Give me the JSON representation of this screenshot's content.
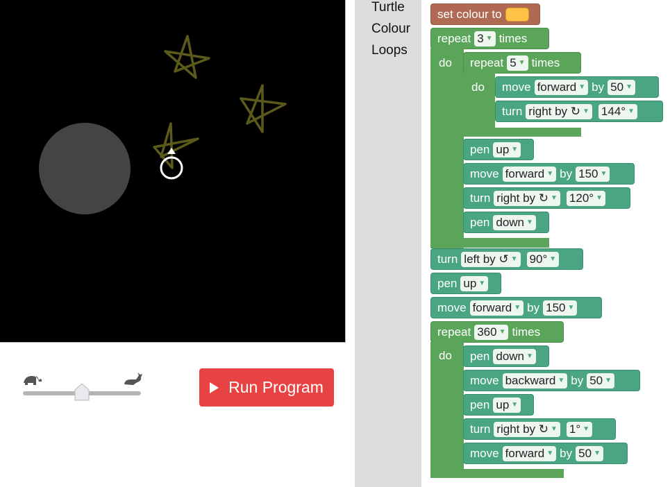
{
  "run_button": {
    "label": "Run Program"
  },
  "toolbox": {
    "items": [
      "Turtle",
      "Colour",
      "Loops"
    ]
  },
  "blocks": {
    "set_colour": {
      "label": "set colour to",
      "colour": "#ffc247"
    },
    "repeat_outer": {
      "label": "repeat",
      "count": "3",
      "times": "times",
      "do": "do"
    },
    "repeat_inner": {
      "label": "repeat",
      "count": "5",
      "times": "times",
      "do": "do"
    },
    "move1": {
      "label": "move",
      "dir": "forward",
      "by": "by",
      "amount": "50"
    },
    "turn1": {
      "label": "turn",
      "dir": "right by ↻",
      "angle": "144°"
    },
    "pen1": {
      "label": "pen",
      "state": "up"
    },
    "move2": {
      "label": "move",
      "dir": "forward",
      "by": "by",
      "amount": "150"
    },
    "turn2": {
      "label": "turn",
      "dir": "right by ↻",
      "angle": "120°"
    },
    "pen2": {
      "label": "pen",
      "state": "down"
    },
    "turn3": {
      "label": "turn",
      "dir": "left by ↺",
      "angle": "90°"
    },
    "pen3": {
      "label": "pen",
      "state": "up"
    },
    "move3": {
      "label": "move",
      "dir": "forward",
      "by": "by",
      "amount": "150"
    },
    "repeat_360": {
      "label": "repeat",
      "count": "360",
      "times": "times",
      "do": "do"
    },
    "pen4": {
      "label": "pen",
      "state": "down"
    },
    "move4": {
      "label": "move",
      "dir": "backward",
      "by": "by",
      "amount": "50"
    },
    "pen5": {
      "label": "pen",
      "state": "up"
    },
    "turn4": {
      "label": "turn",
      "dir": "right by ↻",
      "angle": "1°"
    },
    "move5": {
      "label": "move",
      "dir": "forward",
      "by": "by",
      "amount": "50"
    }
  },
  "colors": {
    "canvas_bg": "#000000",
    "star": "#5c5a1a",
    "circle": "#444444",
    "run": "#e84343",
    "loop_block": "#5ba55b",
    "turtle_block": "#4aa583",
    "colour_block": "#b06a54"
  }
}
